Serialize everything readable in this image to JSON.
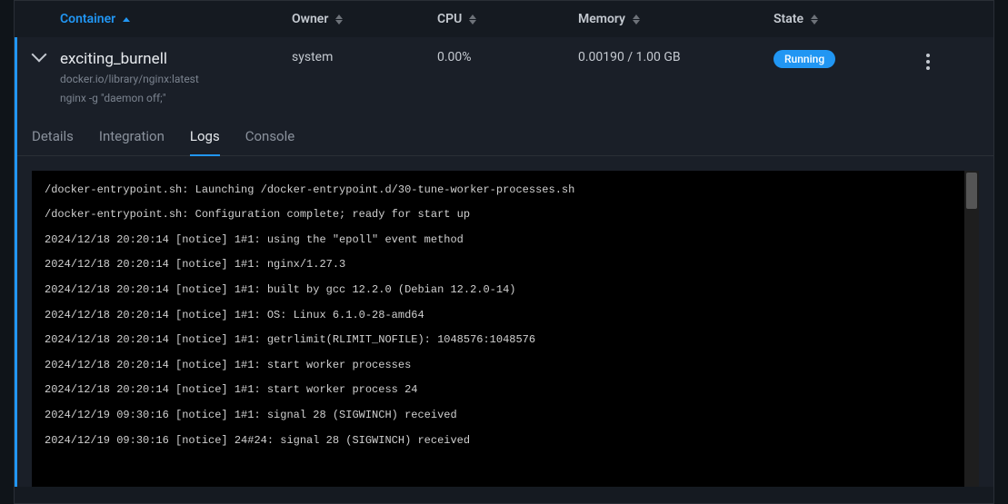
{
  "columns": {
    "container": "Container",
    "owner": "Owner",
    "cpu": "CPU",
    "memory": "Memory",
    "state": "State"
  },
  "row": {
    "name": "exciting_burnell",
    "image": "docker.io/library/nginx:latest",
    "command": "nginx -g \"daemon off;\"",
    "owner": "system",
    "cpu": "0.00%",
    "memory": "0.00190 / 1.00 GB",
    "state": "Running"
  },
  "tabs": {
    "details": "Details",
    "integration": "Integration",
    "logs": "Logs",
    "console": "Console"
  },
  "logs": [
    "/docker-entrypoint.sh: Launching /docker-entrypoint.d/30-tune-worker-processes.sh",
    "/docker-entrypoint.sh: Configuration complete; ready for start up",
    "2024/12/18 20:20:14 [notice] 1#1: using the \"epoll\" event method",
    "2024/12/18 20:20:14 [notice] 1#1: nginx/1.27.3",
    "2024/12/18 20:20:14 [notice] 1#1: built by gcc 12.2.0 (Debian 12.2.0-14)",
    "2024/12/18 20:20:14 [notice] 1#1: OS: Linux 6.1.0-28-amd64",
    "2024/12/18 20:20:14 [notice] 1#1: getrlimit(RLIMIT_NOFILE): 1048576:1048576",
    "2024/12/18 20:20:14 [notice] 1#1: start worker processes",
    "2024/12/18 20:20:14 [notice] 1#1: start worker process 24",
    "2024/12/19 09:30:16 [notice] 1#1: signal 28 (SIGWINCH) received",
    "2024/12/19 09:30:16 [notice] 24#24: signal 28 (SIGWINCH) received"
  ]
}
